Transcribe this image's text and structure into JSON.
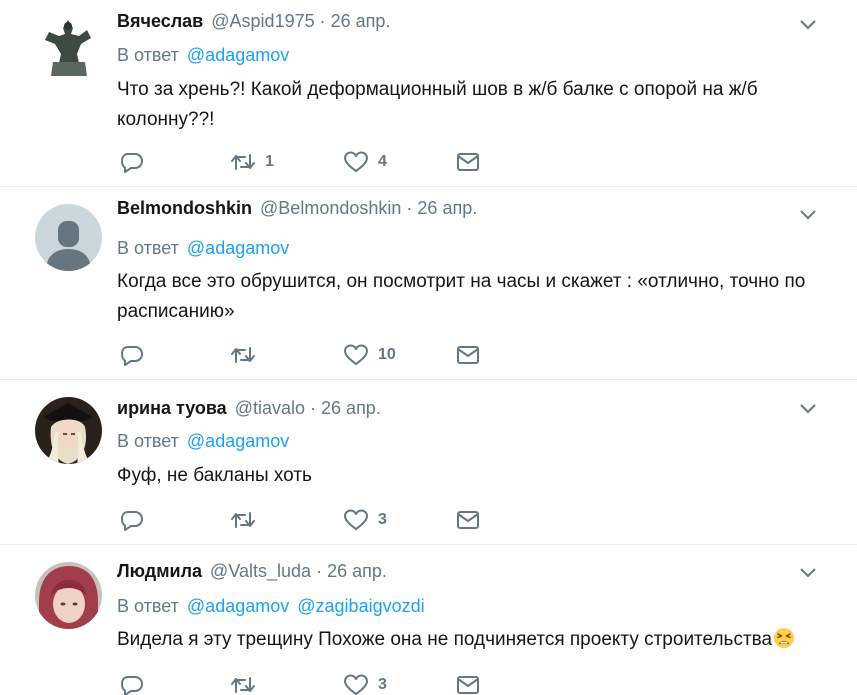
{
  "reply_prefix": "В ответ",
  "dot": "·",
  "tweets": [
    {
      "name": "Вячеслав",
      "handle": "@Aspid1975",
      "date": "26 апр.",
      "mentions": [
        "@adagamov"
      ],
      "text": "Что за хрень?!  Какой деформационный шов в ж/б балке с опорой на ж/б колонну??!",
      "counts": {
        "reply": "",
        "retweet": "1",
        "like": "4"
      },
      "avatar_icon": "statue-avatar"
    },
    {
      "name": "Belmondoshkin",
      "handle": "@Belmondoshkin",
      "date": "26 апр.",
      "mentions": [
        "@adagamov"
      ],
      "text": "Когда все это обрушится, он посмотрит на часы и скажет : «отлично, точно по расписанию»",
      "counts": {
        "reply": "",
        "retweet": "",
        "like": "10"
      },
      "avatar_icon": "default-person-avatar"
    },
    {
      "name": "ирина туова",
      "handle": "@tiavalo",
      "date": "26 апр.",
      "mentions": [
        "@adagamov"
      ],
      "text": "Фуф, не бакланы хоть",
      "counts": {
        "reply": "",
        "retweet": "",
        "like": "3"
      },
      "avatar_icon": "photo-avatar"
    },
    {
      "name": "Людмила",
      "handle": "@Valts_luda",
      "date": "26 апр.",
      "mentions": [
        "@adagamov",
        "@zagibaigvozdi"
      ],
      "text": "Видела я эту трещину  Похоже она не подчиняется проекту строительства",
      "emoji": "tired-face-emoji",
      "counts": {
        "reply": "",
        "retweet": "",
        "like": "3"
      },
      "avatar_icon": "photo-avatar"
    }
  ],
  "colors": {
    "text": "#14171a",
    "secondary": "#657786",
    "link": "#1da1f2",
    "divider": "#e6ecf0"
  }
}
